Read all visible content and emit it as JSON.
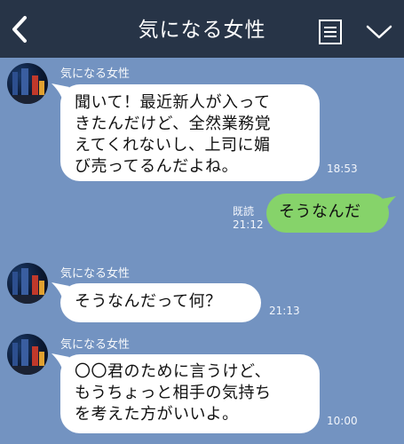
{
  "header": {
    "title": "気になる女性"
  },
  "messages": [
    {
      "sender": "気になる女性",
      "text": "聞いて！最近新人が入って\nきたんだけど、全然業務覚\nえてくれないし、上司に媚\nび売ってるんだよね。",
      "time": "18:53"
    },
    {
      "text": "そうなんだ",
      "read": "既読",
      "time": "21:12"
    },
    {
      "sender": "気になる女性",
      "text": "そうなんだって何？",
      "time": "21:13"
    },
    {
      "sender": "気になる女性",
      "text": "〇〇君のために言うけど、\nもうちょっと相手の気持ち\nを考えた方がいいよ。",
      "time": "10:00"
    }
  ],
  "colors": {
    "background": "#7393c1",
    "header": "#273447",
    "incoming_bubble": "#ffffff",
    "outgoing_bubble": "#86d36a"
  },
  "icons": {
    "back": "chevron-left-icon",
    "menu": "menu-icon",
    "more": "chevron-down-icon"
  }
}
